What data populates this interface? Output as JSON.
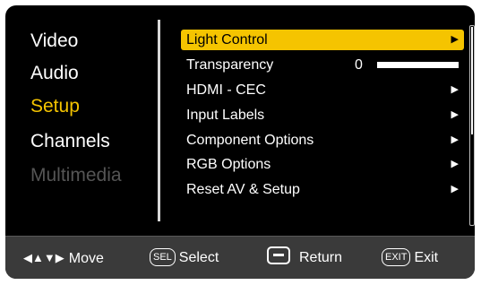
{
  "categories": [
    {
      "label": "Video",
      "state": "normal"
    },
    {
      "label": "Audio",
      "state": "normal"
    },
    {
      "label": "Setup",
      "state": "active"
    },
    {
      "label": "Channels",
      "state": "normal"
    },
    {
      "label": "Multimedia",
      "state": "disabled"
    }
  ],
  "submenu": {
    "items": [
      {
        "label": "Light Control",
        "arrow": "▶",
        "selected": true
      },
      {
        "label": "Transparency",
        "value": "0",
        "level": 0
      },
      {
        "label": "HDMI - CEC",
        "arrow": "▶"
      },
      {
        "label": "Input Labels",
        "arrow": "▶"
      },
      {
        "label": "Component Options",
        "arrow": "▶"
      },
      {
        "label": "RGB Options",
        "arrow": "▶"
      },
      {
        "label": "Reset AV & Setup",
        "arrow": "▶"
      }
    ]
  },
  "footer": {
    "move_icon": "◀▲▼▶",
    "move_label": "Move",
    "select_key": "SEL",
    "select_label": "Select",
    "return_label": "Return",
    "exit_key": "EXIT",
    "exit_label": "Exit"
  },
  "colors": {
    "highlight": "#f5c400",
    "background": "#000000",
    "footer_bg": "#3a3a3a",
    "disabled": "#555555"
  },
  "icons": {
    "submenu_arrow": "triangle-right-icon",
    "return": "minus-rounded-icon",
    "move": "four-way-arrow-icon"
  }
}
